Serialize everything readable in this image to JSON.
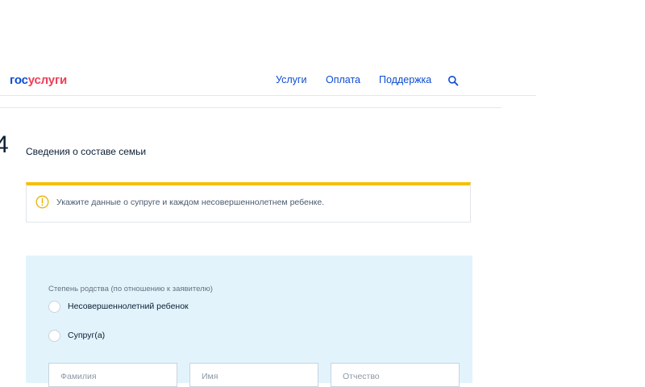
{
  "header": {
    "logo_part1": "гос",
    "logo_part2": "услуги",
    "nav": [
      "Услуги",
      "Оплата",
      "Поддержка"
    ],
    "search_icon": "search-icon"
  },
  "step": {
    "number": "4",
    "title": "Сведения о составе семьи"
  },
  "alert": {
    "icon": "warning-circle-icon",
    "text": "Укажите данные о супруге и каждом несовершеннолетнем ребенке."
  },
  "family_form": {
    "relation_label": "Степень родства (по отношению к заявителю)",
    "options": [
      "Несовершеннолетний ребенок",
      "Супруг(а)"
    ],
    "fields": {
      "surname_placeholder": "Фамилия",
      "name_placeholder": "Имя",
      "patronymic_placeholder": "Отчество"
    }
  },
  "colors": {
    "brand_blue": "#0d4cd3",
    "brand_red": "#ee3f58",
    "alert_yellow": "#f6c000",
    "panel_bg": "#e2f3fc"
  }
}
